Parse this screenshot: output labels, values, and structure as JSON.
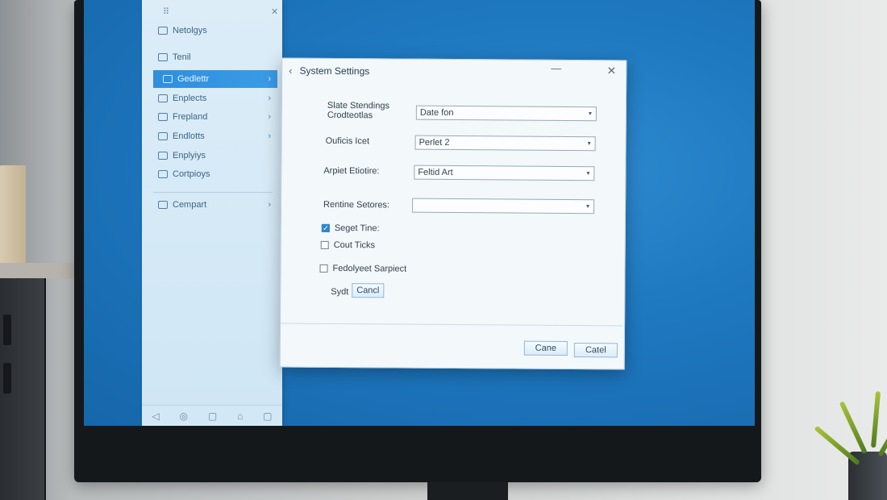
{
  "sidebar": {
    "items": [
      {
        "label": "Netolgys",
        "active": false,
        "chevron": false,
        "icon": "folder-icon"
      },
      {
        "label": "Tenil",
        "active": false,
        "chevron": false,
        "icon": "lock-icon"
      },
      {
        "label": "Gedlettr",
        "active": true,
        "chevron": true,
        "icon": "grid-icon"
      },
      {
        "label": "Enplects",
        "active": false,
        "chevron": true,
        "icon": "grid-icon"
      },
      {
        "label": "Frepland",
        "active": false,
        "chevron": true,
        "icon": "grid-icon"
      },
      {
        "label": "Endlotts",
        "active": false,
        "chevron": true,
        "icon": "grid-icon"
      },
      {
        "label": "Enplyiys",
        "active": false,
        "chevron": false,
        "icon": "folder-icon"
      },
      {
        "label": "Cortpioys",
        "active": false,
        "chevron": false,
        "icon": "folder-icon"
      },
      {
        "label": "Cempart",
        "active": false,
        "chevron": true,
        "icon": "monitor-icon"
      }
    ],
    "chevron_glyph": "›",
    "top_left_glyph": "⠿",
    "top_right_glyph": "✕",
    "bottom_icons": [
      "◁",
      "◎",
      "▢",
      "⌂",
      "▢"
    ]
  },
  "dialog": {
    "back_glyph": "‹",
    "title": "System Settings",
    "min_glyph": "—",
    "close_glyph": "✕",
    "fields": [
      {
        "label_line1": "Slate Stendings",
        "label_line2": "Crodteotlas",
        "value": "Date fon"
      },
      {
        "label_line1": "Ouficis Icet",
        "label_line2": "",
        "value": "Perlet 2"
      },
      {
        "label_line1": "Arpiet Etiotire:",
        "label_line2": "",
        "value": "Feltid Art"
      },
      {
        "label_line1": "Rentine Setores:",
        "label_line2": "",
        "value": ""
      }
    ],
    "caret_glyph": "▾",
    "checkboxes": [
      {
        "label": "Seget Tine:",
        "checked": true
      },
      {
        "label": "Cout Ticks",
        "checked": false
      },
      {
        "label": "Fedolyeet Sarpiect",
        "checked": false
      }
    ],
    "inline_label": "Sydt",
    "inline_button": "Cancl",
    "footer_buttons": [
      "Cane",
      "Catel"
    ]
  },
  "colors": {
    "desktop": "#1f79c1",
    "accent": "#2f8fdd",
    "sidebar_bg": "#d6eaf7"
  }
}
